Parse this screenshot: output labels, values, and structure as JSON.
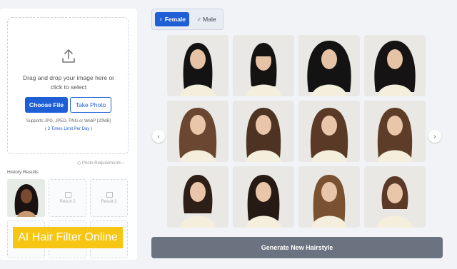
{
  "upload": {
    "icon": "upload-icon",
    "drop_text": "Drag and drop your image here or click to select",
    "choose_file": "Choose File",
    "take_photo": "Take Photo",
    "supports": "Supports JPG, JPEG, PNG or WebP (20MB)",
    "limit": "( 3 Times Limit Per Day )"
  },
  "photo_requirements": "Photo Requirements",
  "history": {
    "title": "History Results",
    "result2": "Result 2",
    "result3": "Result 3"
  },
  "banner": "AI Hair Filter Online",
  "gender": {
    "female": "Female",
    "male": "Male",
    "female_icon": "♀",
    "male_icon": "♂"
  },
  "nav": {
    "prev": "‹",
    "next": "›"
  },
  "generate": "Generate New Hairstyle",
  "colors": {
    "accent": "#1f5fd6",
    "banner": "#f7c614",
    "generate": "#6b7280"
  }
}
